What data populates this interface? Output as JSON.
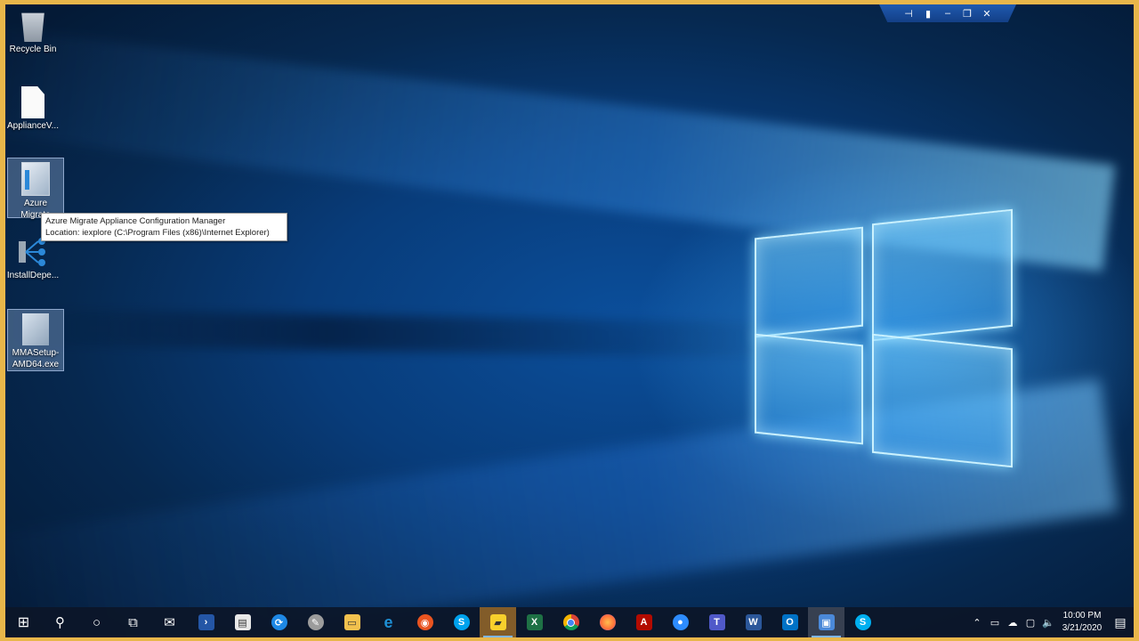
{
  "desktop": {
    "icons": [
      {
        "label": "Recycle Bin",
        "icon": "recycle-bin-icon"
      },
      {
        "label": "ApplianceV...",
        "icon": "document-icon"
      },
      {
        "label": "Azure Migrate",
        "icon": "azure-migrate-icon"
      },
      {
        "label": "InstallDepe...",
        "icon": "install-dependency-icon"
      },
      {
        "label": "MMASetup-AMD64.exe",
        "icon": "mma-setup-icon"
      }
    ],
    "tooltip": {
      "line1": "Azure Migrate Appliance Configuration Manager",
      "line2": "Location: iexplore (C:\\Program Files (x86)\\Internet Explorer)"
    }
  },
  "remote_bar": {
    "buttons": [
      "pin",
      "signal",
      "minimize",
      "restore",
      "close"
    ]
  },
  "taskbar": {
    "items": [
      {
        "name": "start",
        "glyph": "⊞",
        "color": "#ffffff"
      },
      {
        "name": "search",
        "glyph": "⚲",
        "color": "#ffffff"
      },
      {
        "name": "cortana",
        "glyph": "○",
        "color": "#ffffff"
      },
      {
        "name": "task-view",
        "glyph": "⧉",
        "color": "#ffffff"
      },
      {
        "name": "mail",
        "glyph": "✉",
        "color": "#ffffff"
      },
      {
        "name": "powershell",
        "glyph": "›_",
        "color": "#2456a6"
      },
      {
        "name": "store",
        "glyph": "🛍",
        "color": "#e8e8e8"
      },
      {
        "name": "sync",
        "glyph": "⟳",
        "color": "#1e88e5"
      },
      {
        "name": "paint",
        "glyph": "✎",
        "color": "#9c9c9c"
      },
      {
        "name": "file-explorer",
        "glyph": "▭",
        "color": "#f2c14e"
      },
      {
        "name": "internet-explorer",
        "glyph": "e",
        "color": "#1e90d6"
      },
      {
        "name": "ubuntu",
        "glyph": "◉",
        "color": "#e95420"
      },
      {
        "name": "skype-business",
        "glyph": "S",
        "color": "#00a2ed"
      },
      {
        "name": "sticky-notes",
        "glyph": "▰",
        "color": "#f7d02c"
      },
      {
        "name": "excel",
        "glyph": "X",
        "color": "#1e7145"
      },
      {
        "name": "chrome",
        "glyph": "◎",
        "color": "#db4437"
      },
      {
        "name": "firefox",
        "glyph": "◕",
        "color": "#ff7139"
      },
      {
        "name": "acrobat",
        "glyph": "A",
        "color": "#b30b00"
      },
      {
        "name": "zoom",
        "glyph": "●",
        "color": "#2d8cff"
      },
      {
        "name": "teams",
        "glyph": "T",
        "color": "#5059c9"
      },
      {
        "name": "word",
        "glyph": "W",
        "color": "#2b579a"
      },
      {
        "name": "outlook",
        "glyph": "O",
        "color": "#0072c6"
      },
      {
        "name": "remote-desktop",
        "glyph": "▣",
        "color": "#4b89d9"
      },
      {
        "name": "skype",
        "glyph": "S",
        "color": "#00aff0"
      }
    ],
    "tray": {
      "time": "10:00 PM",
      "date": "3/21/2020"
    }
  }
}
